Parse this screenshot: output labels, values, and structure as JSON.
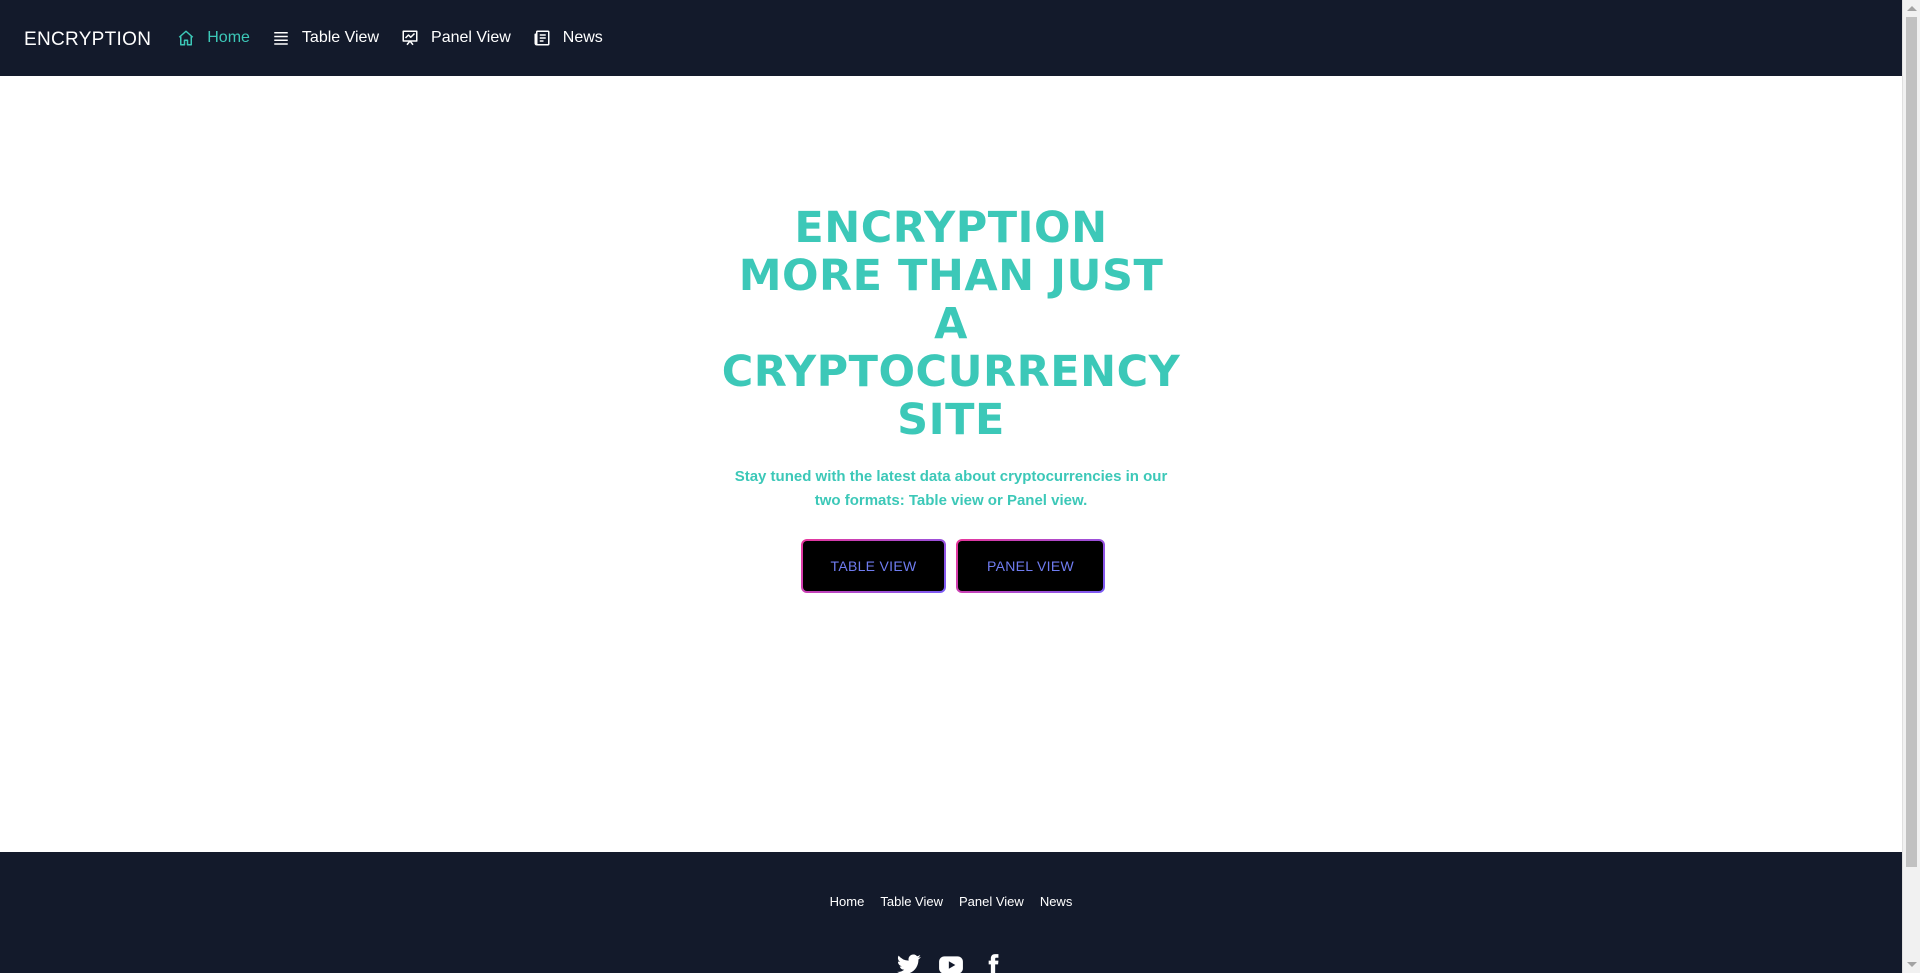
{
  "navbar": {
    "brand": "ENCRYPTION",
    "items": [
      {
        "label": "Home",
        "icon": "home-icon",
        "active": true
      },
      {
        "label": "Table View",
        "icon": "list-icon",
        "active": false
      },
      {
        "label": "Panel View",
        "icon": "presentation-icon",
        "active": false
      },
      {
        "label": "News",
        "icon": "newspaper-icon",
        "active": false
      }
    ]
  },
  "hero": {
    "title_lines": [
      "ENCRYPTION",
      "MORE THAN JUST",
      "A",
      "CRYPTOCURRENCY",
      "SITE"
    ],
    "subtitle": "Stay tuned with the latest data about cryptocurrencies in our two formats: Table view or Panel view.",
    "buttons": {
      "table_view": "TABLE VIEW",
      "panel_view": "PANEL VIEW"
    }
  },
  "footer": {
    "links": [
      "Home",
      "Table View",
      "Panel View",
      "News"
    ],
    "social": [
      "twitter-icon",
      "youtube-icon",
      "facebook-icon"
    ]
  },
  "colors": {
    "nav_bg": "#131a2b",
    "accent": "#3cc8b8",
    "button_text": "#6f7cf0",
    "button_border_start": "#e8359a",
    "button_border_end": "#7a5cf6"
  }
}
